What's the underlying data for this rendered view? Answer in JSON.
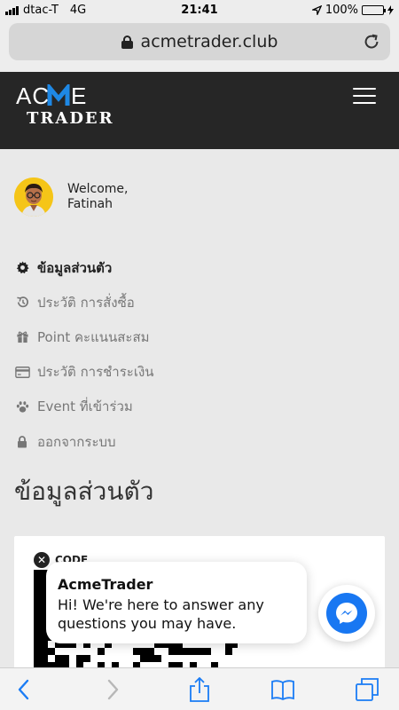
{
  "status_bar": {
    "carrier": "dtac-T",
    "network": "4G",
    "time": "21:41",
    "battery": "100%",
    "battery_level": 1.0
  },
  "browser": {
    "url": "acmetrader.club"
  },
  "site": {
    "logo_top": "ACME",
    "logo_bottom": "TRADER"
  },
  "profile": {
    "welcome": "Welcome,",
    "name": "Fatinah"
  },
  "menu": {
    "items": [
      {
        "label": "ข้อมูลส่วนตัว",
        "icon": "gear-icon"
      },
      {
        "label": "ประวัติ การสั่งซื้อ",
        "icon": "history-icon"
      },
      {
        "label": "Point คะแนนสะสม",
        "icon": "gift-icon"
      },
      {
        "label": "ประวัติ การชำระเงิน",
        "icon": "credit-card-icon"
      },
      {
        "label": "Event ที่เข้าร่วม",
        "icon": "paw-icon"
      },
      {
        "label": "ออกจากระบบ",
        "icon": "lock-icon"
      }
    ]
  },
  "main": {
    "heading": "ข้อมูลส่วนตัว",
    "code_label": "CODE"
  },
  "chat": {
    "name": "AcmeTrader",
    "message": "Hi! We're here to answer any questions you may have."
  },
  "colors": {
    "header_bg": "#262626",
    "accent": "#1e88e5",
    "messenger": "#1877f2",
    "avatar_bg": "#f5c518"
  }
}
